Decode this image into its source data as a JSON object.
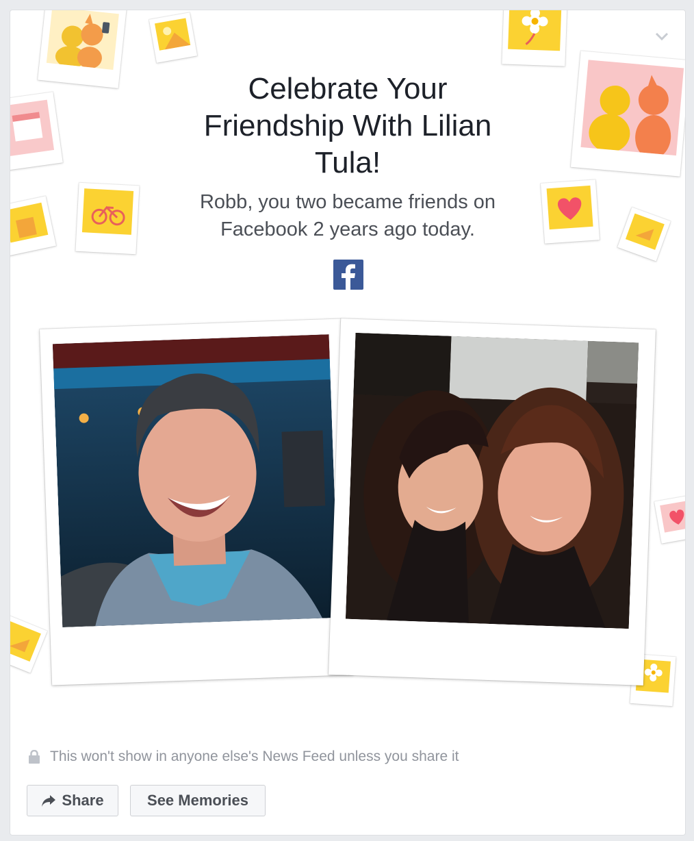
{
  "card": {
    "title": "Celebrate Your Friendship With Lilian Tula!",
    "subtitle": "Robb, you two became friends on Facebook 2 years ago today.",
    "logo_letter": "f",
    "privacy_notice": "This won't show in anyone else's News Feed unless you share it",
    "share_label": "Share",
    "memories_label": "See Memories"
  },
  "icons": {
    "options": "chevron-down-icon",
    "privacy": "lock-icon",
    "share": "share-arrow-icon",
    "logo": "facebook-logo-icon"
  },
  "colors": {
    "facebook_blue": "#3b5998",
    "accent_yellow": "#fbd232",
    "accent_pink": "#f7c6c7",
    "heart_red": "#f25268"
  }
}
